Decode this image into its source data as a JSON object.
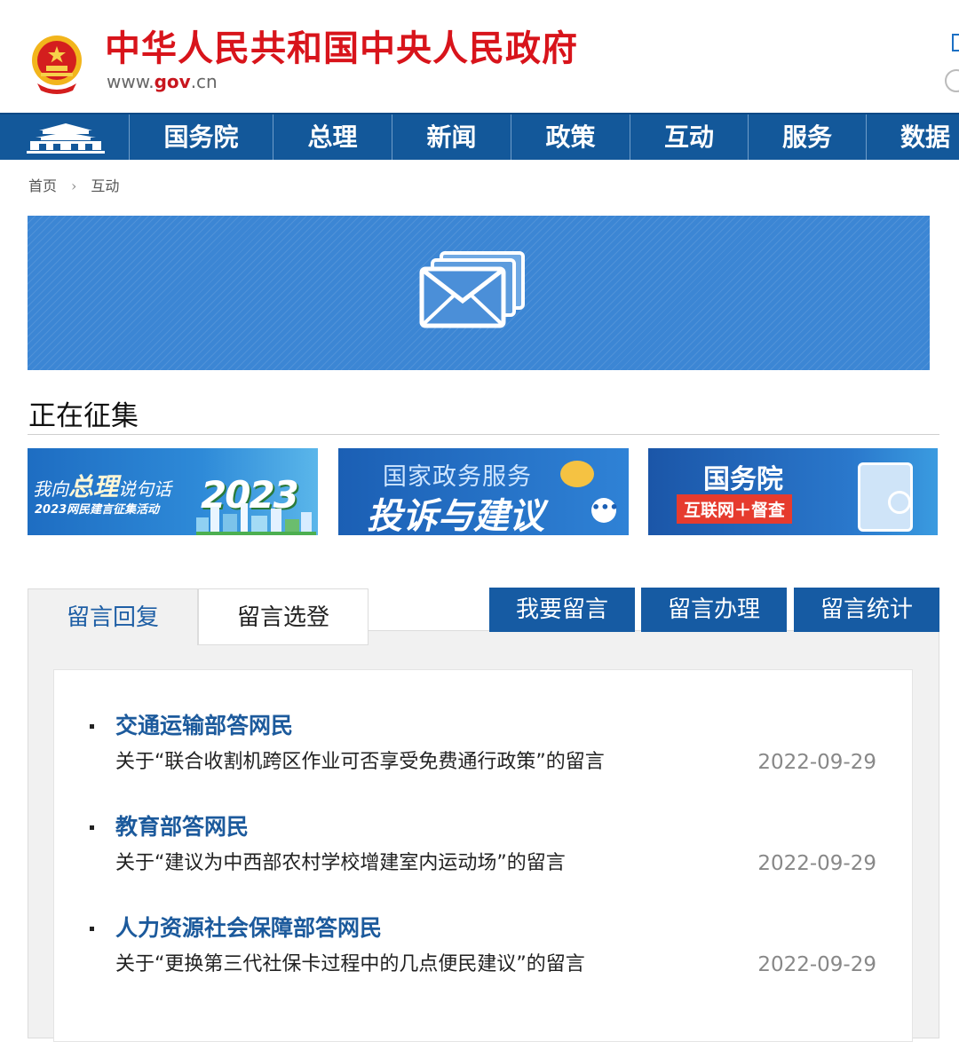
{
  "header": {
    "title": "中华人民共和国中央人民政府",
    "url_prefix": "www.",
    "url_gov": "gov",
    "url_suffix": ".cn"
  },
  "nav": {
    "items": [
      "国务院",
      "总理",
      "新闻",
      "政策",
      "互动",
      "服务",
      "数据"
    ]
  },
  "breadcrumb": {
    "home": "首页",
    "sep": "›",
    "current": "互动"
  },
  "section": {
    "title": "正在征集"
  },
  "promos": {
    "p1": {
      "line1_a": "我向",
      "line1_b": "总理",
      "line1_c": "说句话",
      "line2": "2023网民建言征集活动",
      "year": "2023"
    },
    "p2": {
      "line1": "国家政务服务",
      "line2": "投诉与建议",
      "dots": "•••"
    },
    "p3": {
      "line1": "国务院",
      "line2": "互联网＋督查"
    }
  },
  "tabs": {
    "reply": "留言回复",
    "select": "留言选登"
  },
  "actions": {
    "leave": "我要留言",
    "handle": "留言办理",
    "stats": "留言统计"
  },
  "messages": [
    {
      "title": "交通运输部答网民",
      "desc": "关于“联合收割机跨区作业可否享受免费通行政策”的留言",
      "date": "2022-09-29"
    },
    {
      "title": "教育部答网民",
      "desc": "关于“建议为中西部农村学校增建室内运动场”的留言",
      "date": "2022-09-29"
    },
    {
      "title": "人力资源社会保障部答网民",
      "desc": "关于“更换第三代社保卡过程中的几点便民建议”的留言",
      "date": "2022-09-29"
    }
  ],
  "colors": {
    "brand_red": "#d8141b",
    "nav_blue": "#13589a",
    "link_blue": "#1c5a9c",
    "banner_blue": "#3c86d4"
  }
}
